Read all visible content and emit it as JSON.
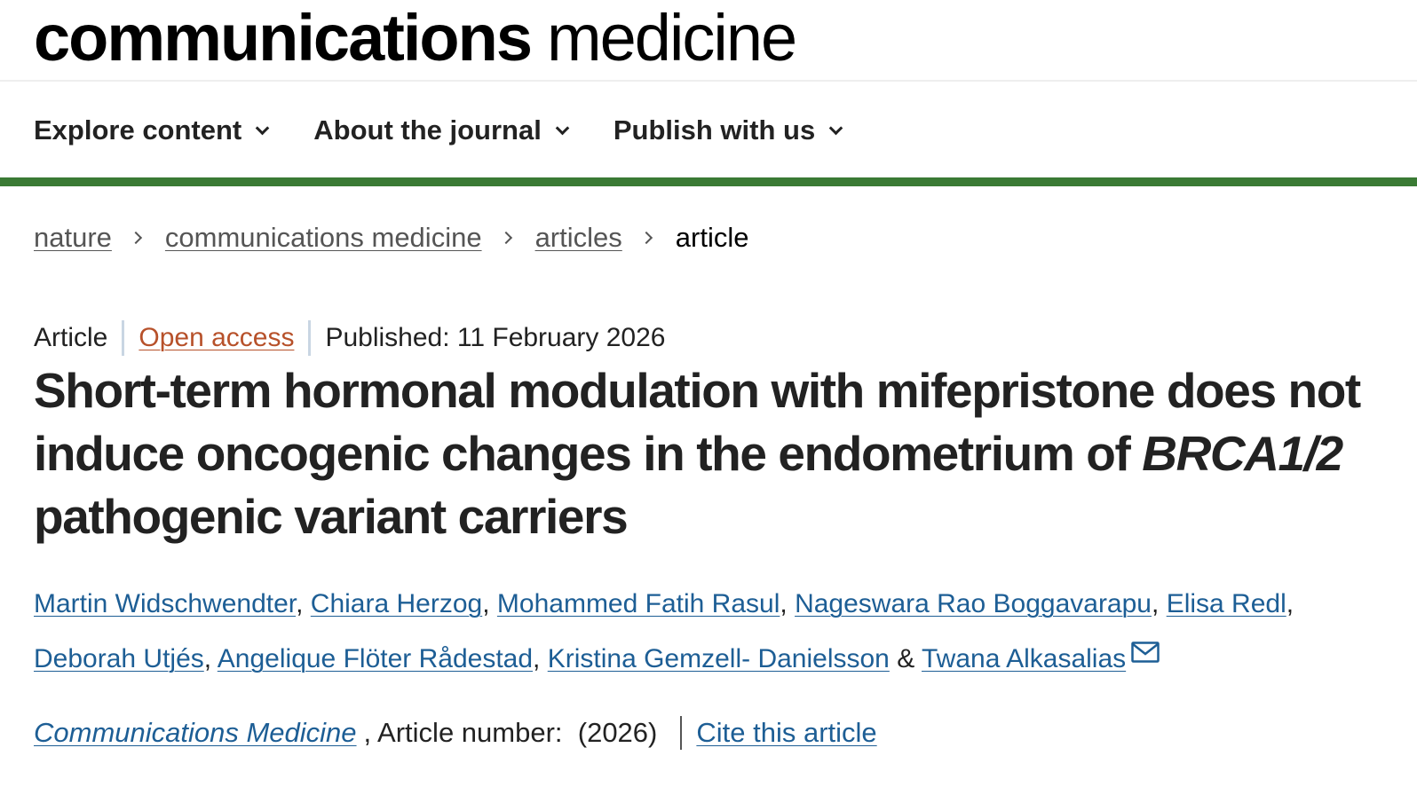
{
  "brand": {
    "bold": "communications",
    "light": "medicine"
  },
  "nav": [
    {
      "label": "Explore content"
    },
    {
      "label": "About the journal"
    },
    {
      "label": "Publish with us"
    }
  ],
  "colors": {
    "accent_bar": "#3a7a34",
    "link": "#1d5e95",
    "open_access": "#b7512a"
  },
  "breadcrumb": [
    "nature",
    "communications medicine",
    "articles",
    "article"
  ],
  "meta": {
    "type": "Article",
    "access": "Open access",
    "published": "Published: 11 February 2026"
  },
  "title": {
    "line_part1": "Short-term hormonal modulation with mifepristone does not induce oncogenic changes in the endometrium of",
    "italic_gene": "BRCA1/2",
    "line_part2": "pathogenic variant carriers"
  },
  "authors": [
    "Martin Widschwendter",
    "Chiara Herzog",
    "Mohammed Fatih Rasul",
    "Nageswara Rao Boggavarapu",
    "Elisa Redl",
    "Deborah Utjés",
    "Angelique Flöter Rådestad",
    "Kristina Gemzell- Danielsson",
    "Twana Alkasalias"
  ],
  "author_separator": ",",
  "author_last_joiner": "&",
  "contact_icon": "envelope-icon",
  "citation": {
    "journal": "Communications Medicine",
    "article_number_text": ", Article number:  (2026)",
    "cite_label": "Cite this article"
  }
}
